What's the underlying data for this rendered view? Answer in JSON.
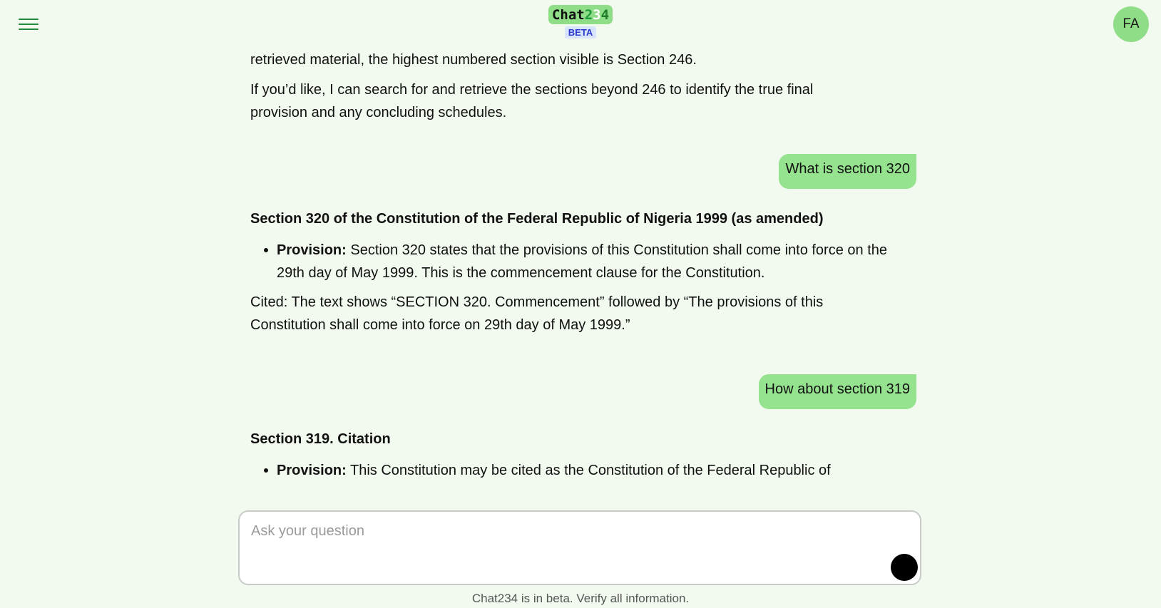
{
  "header": {
    "logo_prefix": "Chat",
    "logo_digit1": "2",
    "logo_digit2": "3",
    "logo_digit3": "4",
    "beta_label": "BETA",
    "avatar_initials": "FA"
  },
  "messages": {
    "assistant_prev": {
      "line1": "retrieved material, the highest numbered section visible is Section 246.",
      "para2": "If you’d like, I can search for and retrieve the sections beyond 246 to identify the true final provision and any concluding schedules."
    },
    "user_1": "What is section 320",
    "assistant_1": {
      "heading": "Section 320 of the Constitution of the Federal Republic of Nigeria 1999 (as amended)",
      "bullet_label": "Provision:",
      "bullet_text": " Section 320 states that the provisions of this Constitution shall come into force on the 29th day of May 1999. This is the commencement clause for the Constitution.",
      "cited": "Cited: The text shows “SECTION 320. Commencement” followed by “The provisions of this Constitution shall come into force on 29th day of May 1999.”"
    },
    "user_2": "How about section 319",
    "assistant_2": {
      "heading": "Section 319. Citation",
      "bullet_label": "Provision:",
      "bullet_text": " This Constitution may be cited as the Constitution of the Federal Republic of"
    }
  },
  "composer": {
    "placeholder": "Ask your question",
    "value": ""
  },
  "footer": {
    "disclaimer": "Chat234 is in beta. Verify all information."
  }
}
